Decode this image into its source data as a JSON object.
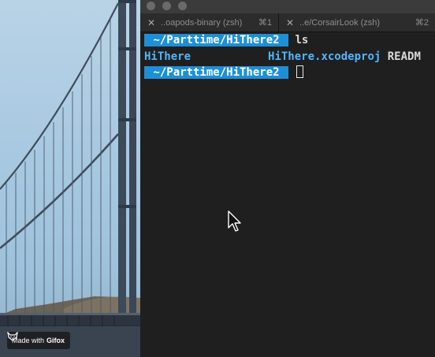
{
  "wallpaper": {
    "badge_prefix": "Made with",
    "badge_brand": "Gifox",
    "icons": {
      "logo": "fox-icon"
    }
  },
  "terminal": {
    "tabs": [
      {
        "title": "..oapods-binary (zsh)",
        "shortcut": "⌘1",
        "active": false
      },
      {
        "title": "..e/CorsairLook (zsh)",
        "shortcut": "⌘2",
        "active": false
      }
    ],
    "lines": [
      {
        "prompt": " ~/Parttime/HiThere2 ",
        "command": "ls"
      },
      {
        "entries": [
          "HiThere",
          "HiThere.xcodeproj",
          "READM"
        ]
      },
      {
        "prompt": " ~/Parttime/HiThere2 ",
        "command": ""
      }
    ],
    "colors": {
      "prompt_bg": "#1d8fd8",
      "directory": "#4fb6ff",
      "background": "#1f1f1f"
    },
    "icons": {
      "tab_close": "close-icon",
      "mouse": "mouse-pointer-icon"
    }
  }
}
